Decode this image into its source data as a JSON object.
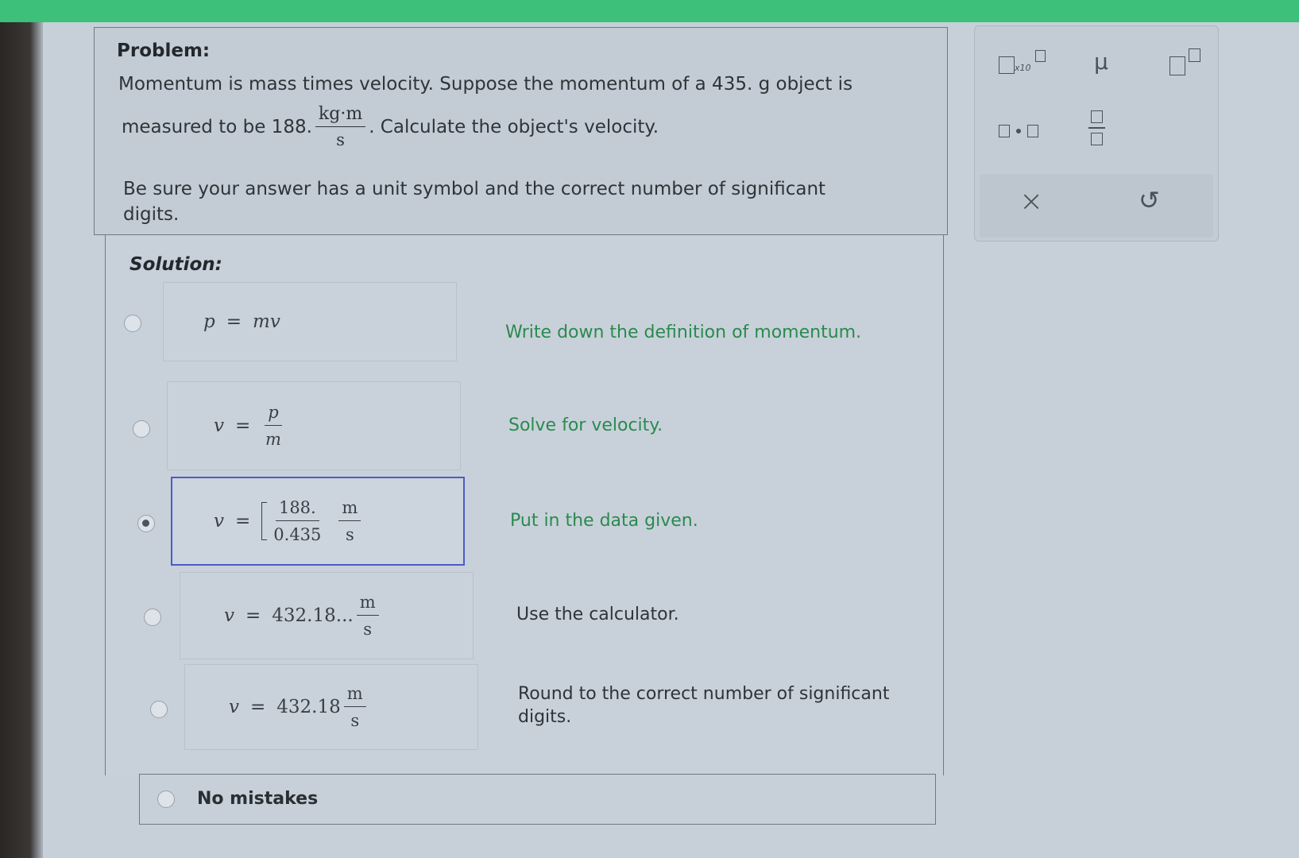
{
  "problem": {
    "label": "Problem:",
    "line1": "Momentum is mass times velocity. Suppose the momentum of a 435. g object is",
    "line2_prefix": "measured to be 188.",
    "unit_num": "kg·m",
    "unit_den": "s",
    "line2_suffix": ". Calculate the object's velocity.",
    "line3": "Be sure your answer has a unit symbol and the correct number of significant",
    "line4": "digits."
  },
  "solution": {
    "label": "Solution:",
    "steps": [
      {
        "equation": {
          "lhs": "p",
          "eq": "=",
          "rhs": "mv"
        },
        "explanation": "Write down the definition of momentum."
      },
      {
        "equation": {
          "lhs": "v",
          "eq": "=",
          "num": "p",
          "den": "m"
        },
        "explanation": "Solve for velocity."
      },
      {
        "equation": {
          "lhs": "v",
          "eq": "=",
          "num": "188.",
          "den": "0.435",
          "unit_num": "m",
          "unit_den": "s"
        },
        "explanation": "Put in the data given."
      },
      {
        "equation": {
          "lhs": "v",
          "eq": "=",
          "value": "432.18...",
          "unit_num": "m",
          "unit_den": "s"
        },
        "explanation": "Use the calculator."
      },
      {
        "equation": {
          "lhs": "v",
          "eq": "=",
          "value": "432.18",
          "unit_num": "m",
          "unit_den": "s"
        },
        "explanation_line1": "Round to the correct number of significant",
        "explanation_line2": "digits."
      }
    ],
    "selected_step": 3,
    "no_mistakes_label": "No mistakes"
  },
  "tools": {
    "sci_sup_label": "x10",
    "mu_label": "μ",
    "clear_label": "×",
    "undo_label": "↺"
  },
  "colors": {
    "top_bar": "#3cc07a",
    "explanation_green": "#2a8a4e",
    "selected_border": "#4c5cc7"
  }
}
